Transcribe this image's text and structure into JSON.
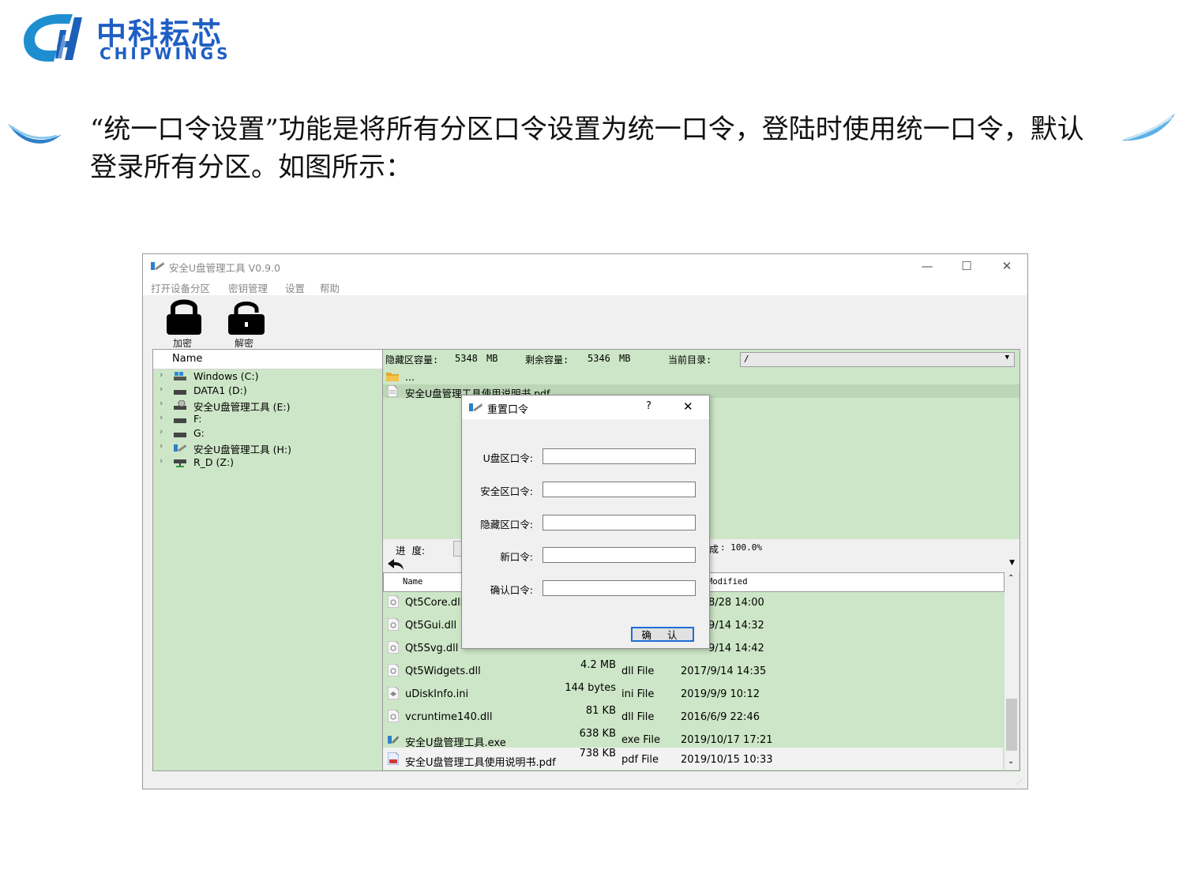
{
  "brand": {
    "cn": "中科耘芯",
    "en": "CHIPWINGS",
    "color": "#1f5fc4"
  },
  "intro": "“统一口令设置”功能是将所有分区口令设置为统一口令，登陆时使用统一口令，默认登录所有分区。如图所示：",
  "window": {
    "title": "安全U盘管理工具 V0.9.0",
    "controls": {
      "minimize": "—",
      "maximize": "☐",
      "close": "✕"
    },
    "menu": [
      "打开设备分区",
      "密钥管理",
      "设置",
      "帮助"
    ],
    "toolbar": {
      "encrypt_label": "加密",
      "decrypt_label": "解密"
    },
    "tree": {
      "header": "Name",
      "items": [
        {
          "label": "Windows (C:)",
          "icon": "windows-drive-icon"
        },
        {
          "label": "DATA1 (D:)",
          "icon": "drive-icon"
        },
        {
          "label": "安全U盘管理工具 (E:)",
          "icon": "cd-drive-icon"
        },
        {
          "label": "F:",
          "icon": "drive-icon"
        },
        {
          "label": "G:",
          "icon": "drive-icon"
        },
        {
          "label": "安全U盘管理工具 (H:)",
          "icon": "app-drive-icon"
        },
        {
          "label": "R_D (Z:)",
          "icon": "network-drive-icon"
        }
      ]
    },
    "hidden_panel": {
      "capacity_label": "隐藏区容量:",
      "capacity_value": "5348",
      "capacity_unit": "MB",
      "free_label": "剩余容量:",
      "free_value": "5346",
      "free_unit": "MB",
      "dir_label": "当前目录:",
      "dir_value": "/",
      "files": [
        {
          "name": "...",
          "icon": "folder-icon"
        },
        {
          "name": "安全U盘管理工具使用说明书.pdf",
          "icon": "document-icon"
        }
      ]
    },
    "progress": {
      "label": "进  度:",
      "done_label": "成",
      "done_value": ": 100.0%"
    },
    "local_table": {
      "col_name": "Name",
      "col_modified": "Modified",
      "rows": [
        {
          "name": "Qt5Core.dll",
          "size": "",
          "type": "",
          "date": "8/28 14:00"
        },
        {
          "name": "Qt5Gui.dll",
          "size": "",
          "type": "",
          "date": "9/14 14:32"
        },
        {
          "name": "Qt5Svg.dll",
          "size": "",
          "type": "",
          "date": "9/14 14:42"
        },
        {
          "name": "Qt5Widgets.dll",
          "size": "4.2 MB",
          "type": "dll File",
          "date": "2017/9/14 14:35"
        },
        {
          "name": "uDiskInfo.ini",
          "size": "144 bytes",
          "type": "ini File",
          "date": "2019/9/9 10:12"
        },
        {
          "name": "vcruntime140.dll",
          "size": "81 KB",
          "type": "dll File",
          "date": "2016/6/9 22:46"
        },
        {
          "name": "安全U盘管理工具.exe",
          "size": "638 KB",
          "type": "exe File",
          "date": "2019/10/17 17:21"
        },
        {
          "name": "安全U盘管理工具使用说明书.pdf",
          "size": "738 KB",
          "type": "pdf File",
          "date": "2019/10/15 10:33"
        }
      ]
    }
  },
  "dialog": {
    "title": "重置口令",
    "help": "?",
    "close": "✕",
    "fields": [
      {
        "label": "U盘区口令:",
        "value": ""
      },
      {
        "label": "安全区口令:",
        "value": ""
      },
      {
        "label": "隐藏区口令:",
        "value": ""
      },
      {
        "label": "新口令:",
        "value": ""
      },
      {
        "label": "确认口令:",
        "value": ""
      }
    ],
    "ok_label": "确 认"
  },
  "colors": {
    "panel_green": "#cde6c7",
    "selection_gray": "#bcd6b6",
    "focus_blue": "#1e6ed8"
  }
}
